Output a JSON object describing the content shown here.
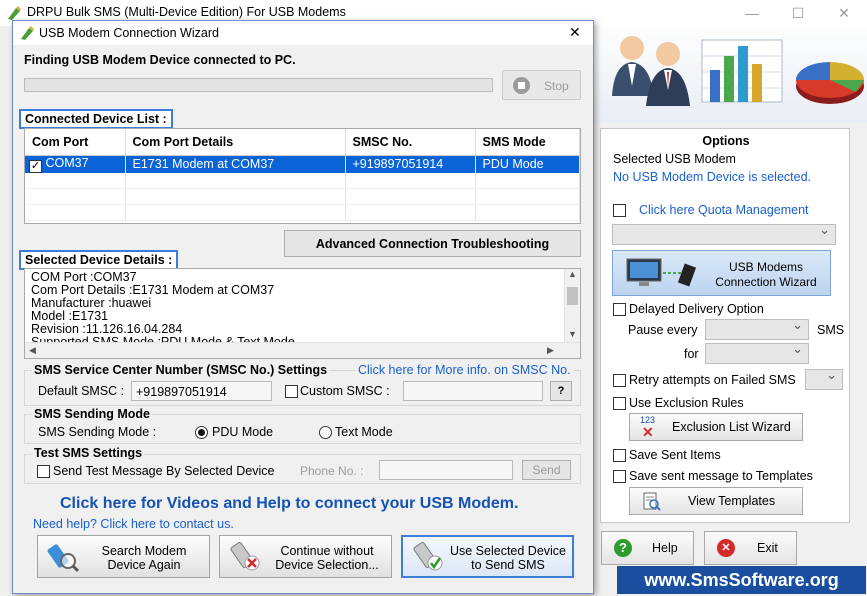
{
  "main_window": {
    "title": "DRPU Bulk SMS (Multi-Device Edition) For USB Modems"
  },
  "wizard": {
    "title": "USB Modem Connection Wizard",
    "status_text": "Finding USB Modem Device connected to PC.",
    "stop_label": "Stop",
    "connected_list_label": "Connected Device List :",
    "table": {
      "headers": [
        "Com Port",
        "Com Port Details",
        "SMSC No.",
        "SMS Mode"
      ],
      "rows": [
        {
          "com_port": "COM37",
          "details": "E1731 Modem at COM37",
          "smsc": "+919897051914",
          "mode": "PDU Mode",
          "checked": true
        }
      ]
    },
    "advanced_button": "Advanced Connection Troubleshooting",
    "selected_details_label": "Selected Device Details :",
    "details_lines": [
      "COM Port :COM37",
      "Com Port Details :E1731 Modem at COM37",
      "Manufacturer :huawei",
      "Model :E1731",
      "Revision :11.126.16.04.284",
      "Supported SMS Mode :PDU Mode & Text Mode"
    ],
    "smsc": {
      "group_label": "SMS Service Center Number (SMSC No.) Settings",
      "info_link": "Click here for More info. on SMSC No.",
      "default_label": "Default SMSC :",
      "default_value": "+919897051914",
      "custom_label": "Custom SMSC :",
      "custom_value": "",
      "help_label": "?"
    },
    "sending_mode": {
      "group_label": "SMS Sending Mode",
      "field_label": "SMS Sending Mode :",
      "pdu_label": "PDU Mode",
      "text_label": "Text Mode",
      "selected": "PDU Mode"
    },
    "test_sms": {
      "group_label": "Test SMS Settings",
      "checkbox_label": "Send Test Message By Selected Device",
      "phone_label": "Phone No. :",
      "phone_value": "",
      "send_label": "Send"
    },
    "videos_link": "Click here for Videos and Help to connect your USB Modem.",
    "contact_link": "Need help? Click here to contact us.",
    "buttons": {
      "search": [
        "Search Modem",
        "Device Again"
      ],
      "continue": [
        "Continue without",
        "Device Selection..."
      ],
      "use": [
        "Use Selected Device",
        "to Send SMS"
      ]
    }
  },
  "options": {
    "title": "Options",
    "selected_modem_label": "Selected USB Modem",
    "no_modem_text": "No USB Modem Device is selected.",
    "quota_link": "Click here Quota Management",
    "usb_wizard_lines": [
      "USB Modems",
      "Connection  Wizard"
    ],
    "delayed_label": "Delayed Delivery Option",
    "pause_label": "Pause every",
    "sms_label": "SMS",
    "for_label": "for",
    "retry_label": "Retry attempts on Failed SMS",
    "exclusion_label": "Use Exclusion Rules",
    "exclusion_wizard": "Exclusion List Wizard",
    "exclusion_icon_text": "123",
    "save_sent_label": "Save Sent Items",
    "save_templates_label": "Save sent message to Templates",
    "view_templates": "View Templates"
  },
  "footer": {
    "help_label": "Help",
    "exit_label": "Exit",
    "website": "www.SmsSoftware.org"
  },
  "colors": {
    "accent": "#0a64d8",
    "link": "#1a5fd0",
    "website_bg": "#1a4fa0",
    "help_icon": "#2e9b2e",
    "exit_icon": "#d42a2a"
  }
}
